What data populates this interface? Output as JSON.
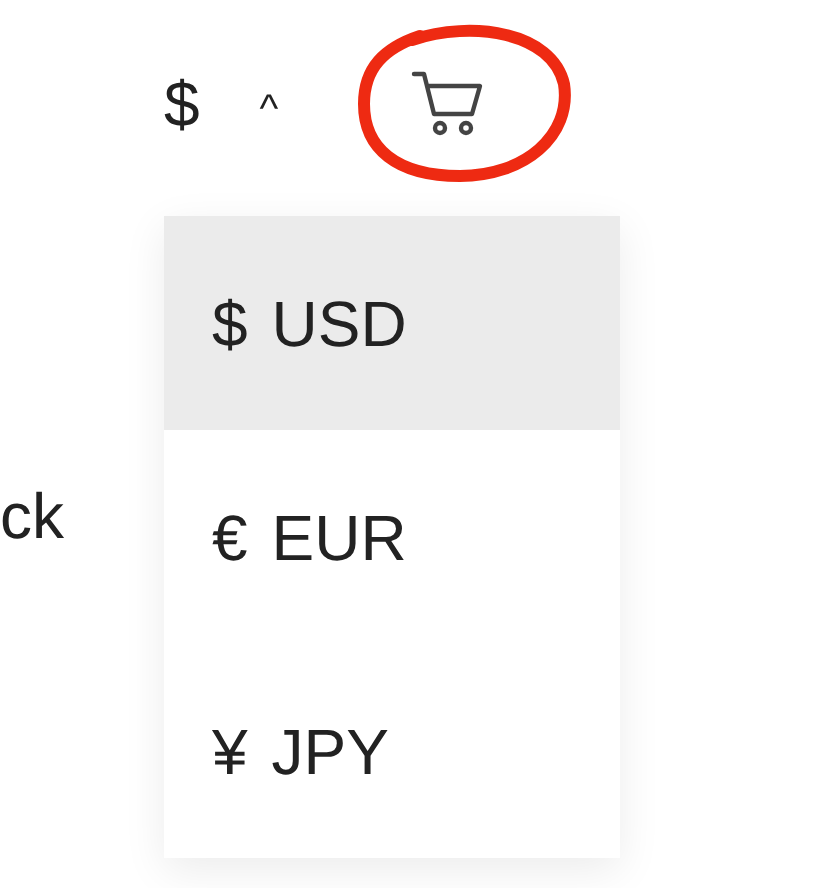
{
  "currency_toggle": {
    "symbol": "$",
    "caret": "^",
    "expanded": true
  },
  "left_text": "ck",
  "currency_menu": [
    {
      "symbol": "$",
      "code": "USD",
      "selected": true
    },
    {
      "symbol": "€",
      "code": "EUR",
      "selected": false
    },
    {
      "symbol": "¥",
      "code": "JPY",
      "selected": false
    }
  ]
}
